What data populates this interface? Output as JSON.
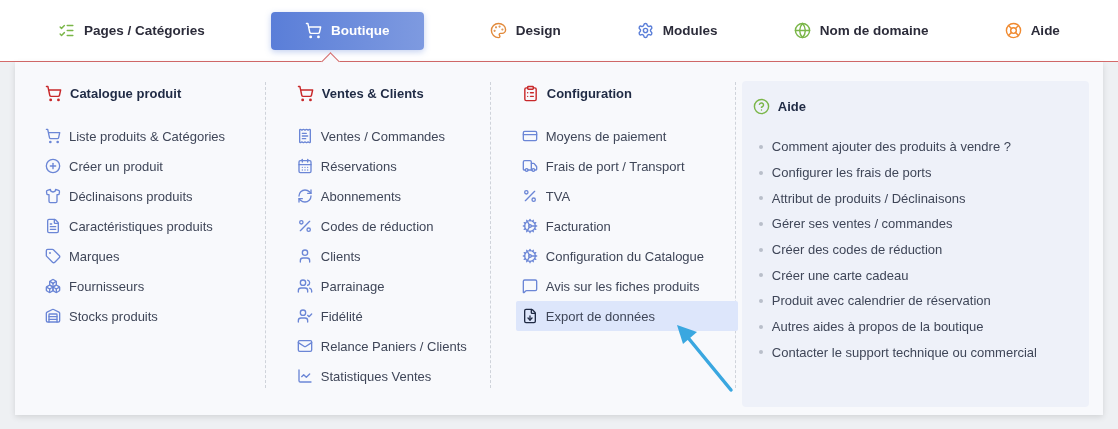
{
  "nav": [
    {
      "label": "Pages / Catégories",
      "selected": false
    },
    {
      "label": "Boutique",
      "selected": true
    },
    {
      "label": "Design",
      "selected": false
    },
    {
      "label": "Modules",
      "selected": false
    },
    {
      "label": "Nom de domaine",
      "selected": false
    },
    {
      "label": "Aide",
      "selected": false
    }
  ],
  "sections": [
    {
      "title": "Catalogue produit",
      "items": [
        {
          "label": "Liste produits & Catégories",
          "selected": false
        },
        {
          "label": "Créer un produit",
          "selected": false
        },
        {
          "label": "Déclinaisons produits",
          "selected": false
        },
        {
          "label": "Caractéristiques produits",
          "selected": false
        },
        {
          "label": "Marques",
          "selected": false
        },
        {
          "label": "Fournisseurs",
          "selected": false
        },
        {
          "label": "Stocks produits",
          "selected": false
        }
      ]
    },
    {
      "title": "Ventes & Clients",
      "items": [
        {
          "label": "Ventes / Commandes",
          "selected": false
        },
        {
          "label": "Réservations",
          "selected": false
        },
        {
          "label": "Abonnements",
          "selected": false
        },
        {
          "label": "Codes de réduction",
          "selected": false
        },
        {
          "label": "Clients",
          "selected": false
        },
        {
          "label": "Parrainage",
          "selected": false
        },
        {
          "label": "Fidélité",
          "selected": false
        },
        {
          "label": "Relance Paniers / Clients",
          "selected": false
        },
        {
          "label": "Statistiques Ventes",
          "selected": false
        }
      ]
    },
    {
      "title": "Configuration",
      "items": [
        {
          "label": "Moyens de paiement",
          "selected": false
        },
        {
          "label": "Frais de port / Transport",
          "selected": false
        },
        {
          "label": "TVA",
          "selected": false
        },
        {
          "label": "Facturation",
          "selected": false
        },
        {
          "label": "Configuration du Catalogue",
          "selected": false
        },
        {
          "label": "Avis sur les fiches produits",
          "selected": false
        },
        {
          "label": "Export de données",
          "selected": true
        }
      ]
    }
  ],
  "help": {
    "title": "Aide",
    "links": [
      "Comment ajouter des produits à vendre ?",
      "Configurer les frais de ports",
      "Attribut de produits / Déclinaisons",
      "Gérer ses ventes / commandes",
      "Créer des codes de réduction",
      "Créer une carte cadeau",
      "Produit avec calendrier de réservation",
      "Autres aides à propos de la boutique",
      "Contacter le support technique ou commercial"
    ]
  }
}
